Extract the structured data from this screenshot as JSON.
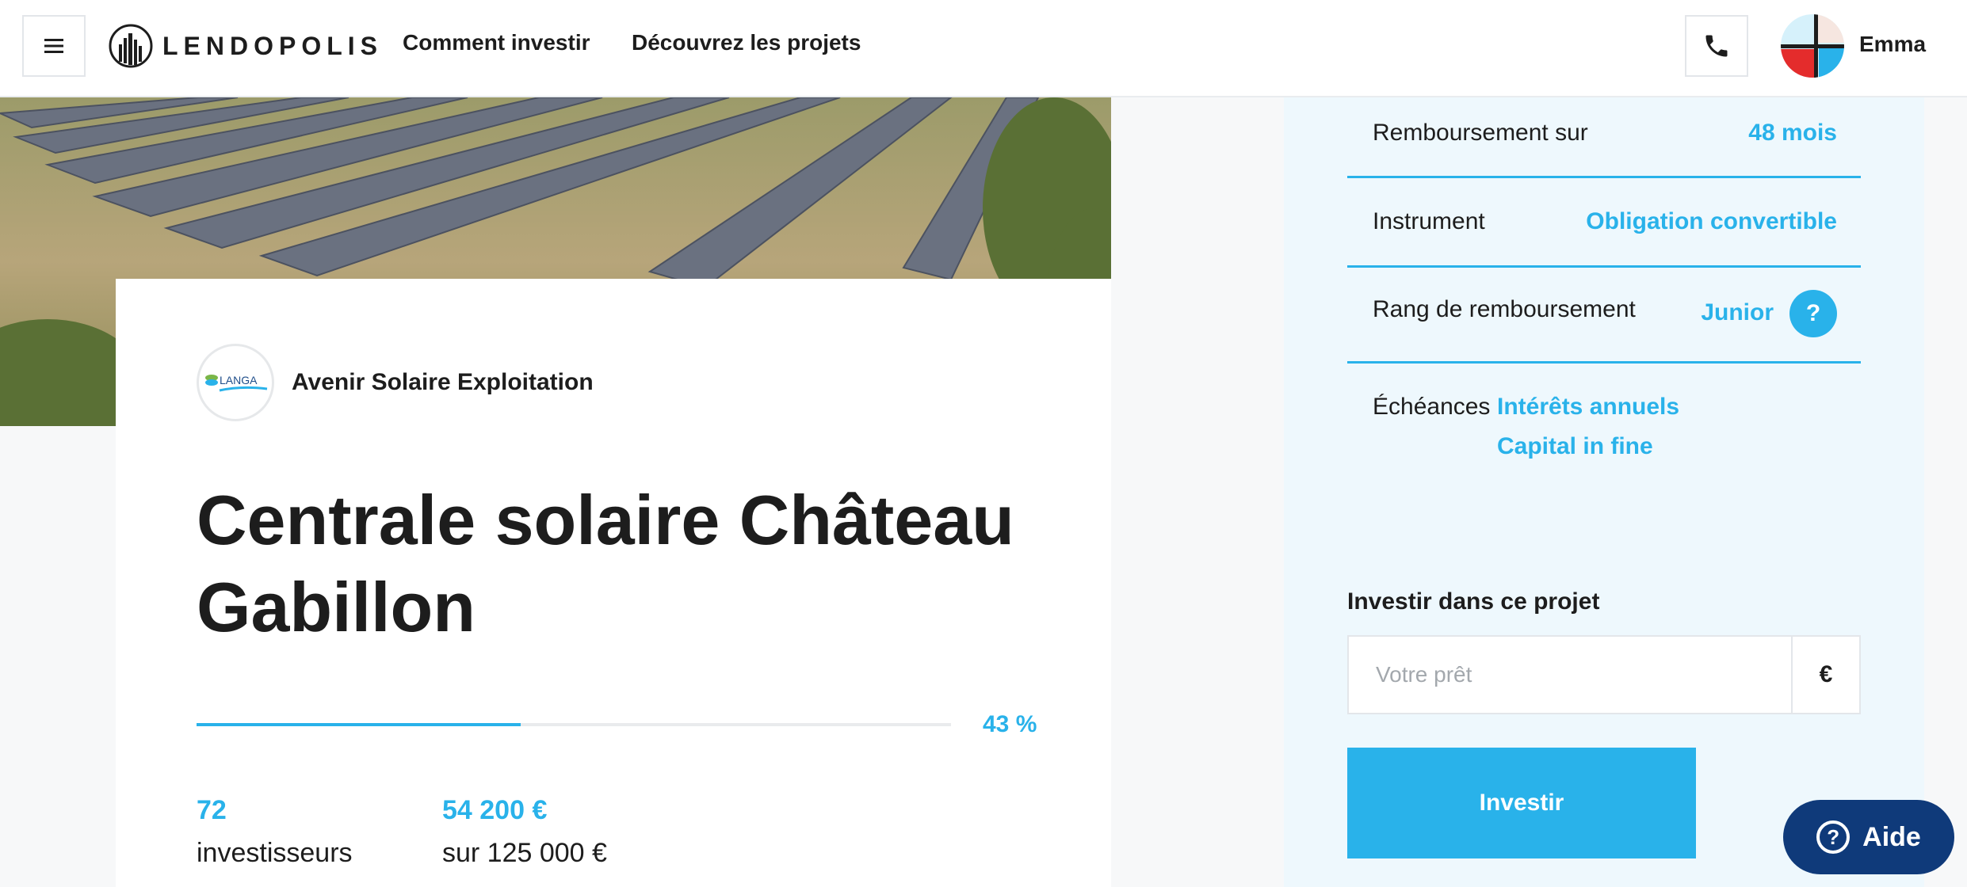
{
  "header": {
    "brand": "LENDOPOLIS",
    "nav": [
      "Comment investir",
      "Découvrez les projets"
    ],
    "user_name": "Emma",
    "icons": [
      "menu-icon",
      "phone-icon",
      "logo-icon"
    ]
  },
  "project": {
    "company_logo_text": "LANGA",
    "company_name": "Avenir Solaire Exploitation",
    "title": "Centrale solaire Château Gabillon",
    "progress_label": "43 %",
    "progress_value": 0.43,
    "stats": [
      {
        "value": "72",
        "label": "investisseurs"
      },
      {
        "value": "54 200 €",
        "label": "sur 125 000 €"
      }
    ]
  },
  "terms": {
    "rows": [
      {
        "label": "Remboursement sur",
        "value": "48 mois"
      },
      {
        "label": "Instrument",
        "value": "Obligation convertible"
      },
      {
        "label": "Rang de remboursement",
        "value": "Junior",
        "help": "?"
      }
    ],
    "echeances_label": "Échéances",
    "echeances_values": [
      "Intérêts annuels",
      "Capital in fine"
    ]
  },
  "invest": {
    "title": "Investir dans ce projet",
    "placeholder": "Votre prêt",
    "currency": "€",
    "button": "Investir"
  },
  "aide": {
    "icon": "?",
    "label": "Aide"
  },
  "colors": {
    "accent": "#29b2ea",
    "dark_blue": "#0f3a7a",
    "panel_bg": "#eef8fd"
  }
}
